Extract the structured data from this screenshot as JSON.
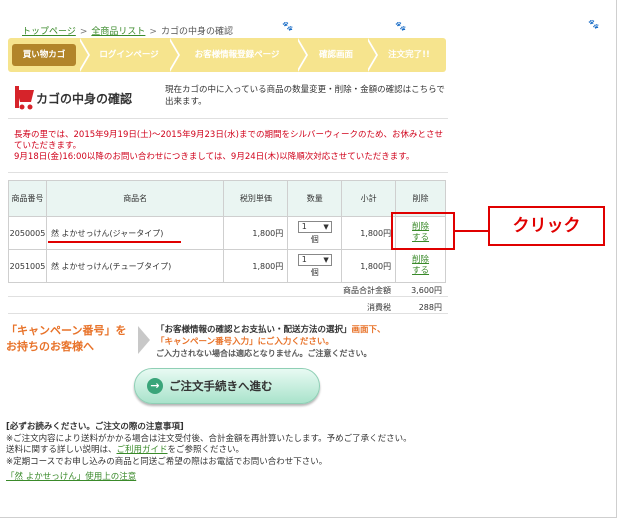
{
  "breadcrumb": {
    "home": "トップページ",
    "products": "全商品リスト",
    "current": "カゴの中身の確認"
  },
  "steps": [
    "買い物カゴ",
    "ログインページ",
    "お客様情報登録ページ",
    "確認画面",
    "注文完了!!"
  ],
  "section": {
    "title": "カゴの中身の確認",
    "description": "現在カゴの中に入っている商品の数量変更・削除・金額の確認はこちらで出来ます。"
  },
  "notice": {
    "line1": "長寿の里では、2015年9月19日(土)〜2015年9月23日(水)までの期間をシルバーウィークのため、お休みとさせていただきます。",
    "line2": "9月18日(金)16:00以降のお問い合わせにつきましては、9月24日(木)以降順次対応させていただきます。"
  },
  "table": {
    "headers": {
      "code": "商品番号",
      "name": "商品名",
      "price": "税別単価",
      "qty": "数量",
      "subtotal": "小計",
      "delete": "削除"
    },
    "qty_unit": "個",
    "rows": [
      {
        "code": "2050005",
        "name": "然 よかせっけん(ジャータイプ)",
        "price": "1,800円",
        "qty": "1",
        "subtotal": "1,800円",
        "delete_line1": "削除",
        "delete_line2": "する"
      },
      {
        "code": "2051005",
        "name": "然 よかせっけん(チューブタイプ)",
        "price": "1,800円",
        "qty": "1",
        "subtotal": "1,800円",
        "delete_line1": "削除",
        "delete_line2": "する"
      }
    ]
  },
  "totals": {
    "sum_label": "商品合計金額",
    "sum_value": "3,600円",
    "tax_label": "消費税",
    "tax_value": "288円"
  },
  "annotation": {
    "callout": "クリック"
  },
  "campaign": {
    "left_line1": "「キャンペーン番号」を",
    "left_line2": "お持ちのお客様へ",
    "right_line1_bold": "「お客様情報の確認とお支払い・配送方法の選択」",
    "right_line1_tail": "画面下、",
    "right_line2": "「キャンペーン番号入力」",
    "right_line2_tail": "にご入力ください。",
    "right_line3": "ご入力されない場合は適応となりません。ご注意ください。"
  },
  "proceed_button": "ご注文手続きへ進む",
  "notes": {
    "heading": "[必ずお読みください。ご注文の際の注意事項]",
    "line1": "※ご注文内容により送料がかかる場合は注文受付後、合計金額を再計算いたします。予めご了承ください。",
    "line2_pre": "送料に関する詳しい説明は、",
    "line2_link": "ご利用ガイド",
    "line2_post": "をご参照ください。",
    "line3": "※定期コースでお申し込みの商品と同送ご希望の際はお電話でお問い合わせ下さい。",
    "usage_link": "「然 よかせっけん」使用上の注意"
  },
  "colors": {
    "accent_green": "#3a8a2a",
    "step_bar": "#f6e48e",
    "step_active": "#b2852a",
    "notice_red": "#d0021b",
    "campaign_orange": "#e8732a",
    "annotation_red": "#e00000"
  }
}
